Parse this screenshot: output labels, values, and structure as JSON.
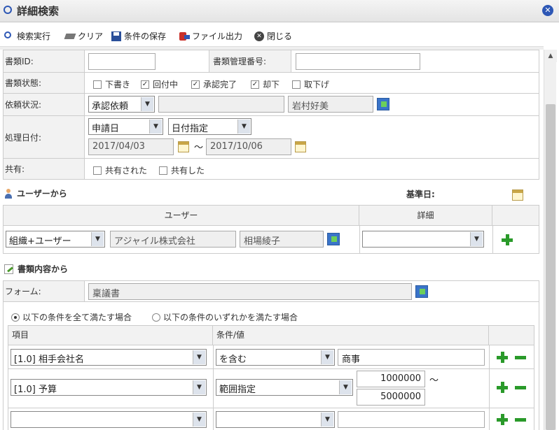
{
  "window": {
    "title": "詳細検索"
  },
  "toolbar": {
    "search": "検索実行",
    "clear": "クリア",
    "save": "条件の保存",
    "file": "ファイル出力",
    "close": "閉じる"
  },
  "form": {
    "doc_id_label": "書類ID:",
    "doc_id_value": "",
    "doc_mgmt_label": "書類管理番号:",
    "doc_mgmt_value": "",
    "status_label": "書類状態:",
    "status_options": [
      {
        "label": "下書き",
        "checked": false
      },
      {
        "label": "回付中",
        "checked": true
      },
      {
        "label": "承認完了",
        "checked": true
      },
      {
        "label": "却下",
        "checked": true
      },
      {
        "label": "取下げ",
        "checked": false
      }
    ],
    "request_label": "依頼状況:",
    "request_select": "承認依頼",
    "request_input": "",
    "request_user": "岩村好美",
    "date_label": "処理日付:",
    "date_type": "申請日",
    "date_mode": "日付指定",
    "date_from": "2017/04/03",
    "date_sep": "〜",
    "date_to": "2017/10/06",
    "share_label": "共有:",
    "share_options": [
      {
        "label": "共有された",
        "checked": false
      },
      {
        "label": "共有した",
        "checked": false
      }
    ]
  },
  "user_section": {
    "title": "ユーザーから",
    "base_date": "基準日:",
    "col_user": "ユーザー",
    "col_detail": "詳細",
    "user_type": "組織+ユーザー",
    "org": "アジャイル株式会社",
    "user": "相場綾子",
    "detail": ""
  },
  "content_section": {
    "title": "書類内容から",
    "form_label": "フォーム:",
    "form_value": "稟議書",
    "match_all": "以下の条件を全て満たす場合",
    "match_any": "以下の条件のいずれかを満たす場合",
    "col_item": "項目",
    "col_cond": "条件/値",
    "rows": [
      {
        "item": "[1.0] 相手会社名",
        "cond": "を含む",
        "value": "商事"
      },
      {
        "item": "[1.0] 予算",
        "cond": "範囲指定",
        "from": "1000000",
        "sep": "〜",
        "to": "5000000"
      },
      {
        "item": "",
        "cond": "",
        "value": ""
      }
    ]
  },
  "colors": {
    "accent": "#2d57b5",
    "plus": "#2a9a2a"
  }
}
